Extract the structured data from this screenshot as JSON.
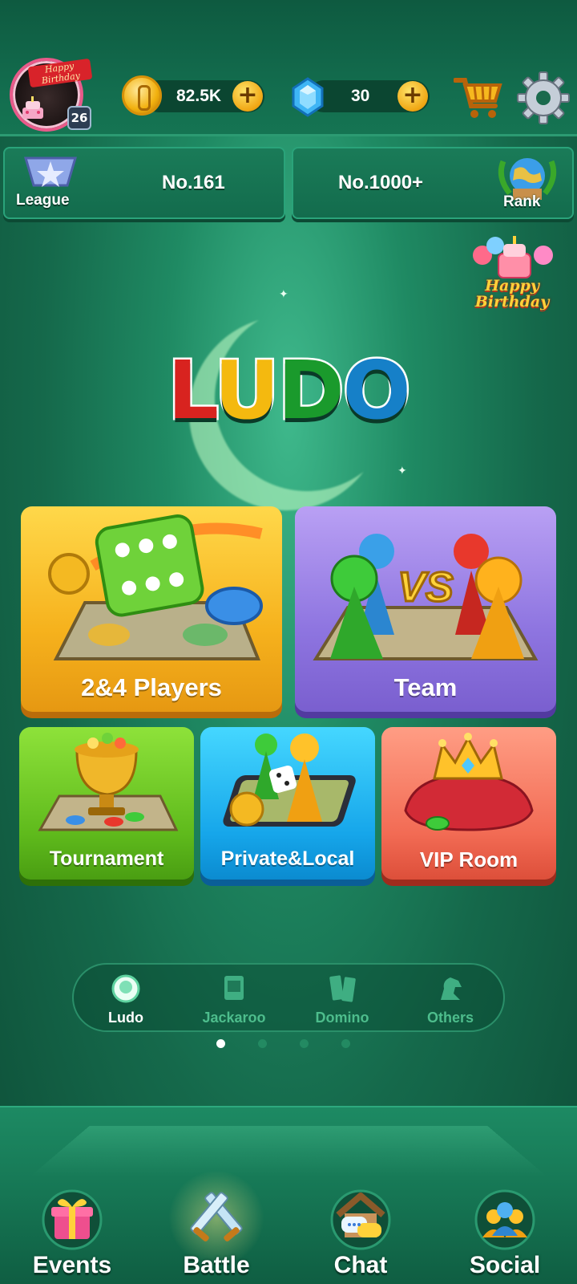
{
  "header": {
    "avatar": {
      "banner_text": "Happy Birthday",
      "level": "26"
    },
    "coins": {
      "value": "82.5K",
      "add_label": "+"
    },
    "gems": {
      "value": "30",
      "add_label": "+"
    },
    "icons": [
      "avatar",
      "coin-icon",
      "gem-icon",
      "shopping-cart-icon",
      "settings-gear-icon"
    ]
  },
  "rank_row": {
    "league": {
      "caption": "League",
      "value": "No.161"
    },
    "rank": {
      "caption": "Rank",
      "value": "No.1000+"
    }
  },
  "event_badge": {
    "text": "Happy Birthday"
  },
  "logo": {
    "letters": [
      "L",
      "U",
      "D",
      "O"
    ],
    "colors": [
      "#d8231f",
      "#f4b90f",
      "#1a9a2c",
      "#1680c8"
    ]
  },
  "modes": {
    "players": "2&4 Players",
    "team": "Team",
    "tournament": "Tournament",
    "private_local": "Private&Local",
    "vip_room": "VIP Room"
  },
  "game_switch": {
    "items": [
      {
        "label": "Ludo",
        "active": true
      },
      {
        "label": "Jackaroo",
        "active": false
      },
      {
        "label": "Domino",
        "active": false
      },
      {
        "label": "Others",
        "active": false
      }
    ],
    "page_dots": {
      "count": 4,
      "active_index": 0
    }
  },
  "bottom_nav": {
    "items": [
      {
        "label": "Events",
        "icon": "gift-icon"
      },
      {
        "label": "Battle",
        "icon": "crossed-swords-icon"
      },
      {
        "label": "Chat",
        "icon": "chat-house-icon"
      },
      {
        "label": "Social",
        "icon": "people-icon"
      }
    ]
  }
}
